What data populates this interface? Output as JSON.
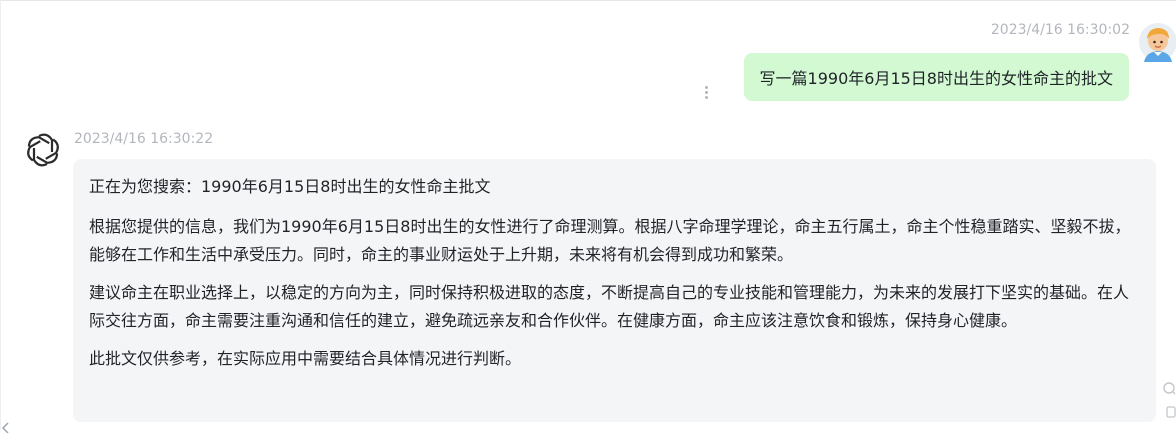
{
  "user_message": {
    "timestamp": "2023/4/16 16:30:02",
    "text": "写一篇1990年6月15日8时出生的女性命主的批文",
    "avatar_icon": "cartoon-person-avatar-icon"
  },
  "bot_message": {
    "timestamp": "2023/4/16 16:30:22",
    "avatar_icon": "openai-logo-icon",
    "paragraphs": [
      "正在为您搜索：1990年6月15日8时出生的女性命主批文",
      "根据您提供的信息，我们为1990年6月15日8时出生的女性进行了命理测算。根据八字命理学理论，命主五行属土，命主个性稳重踏实、坚毅不拔，能够在工作和生活中承受压力。同时，命主的事业财运处于上升期，未来将有机会得到成功和繁荣。",
      "建议命主在职业选择上，以稳定的方向为主，同时保持积极进取的态度，不断提高自己的专业技能和管理能力，为未来的发展打下坚实的基础。在人际交往方面，命主需要注重沟通和信任的建立，避免疏远亲友和合作伙伴。在健康方面，命主应该注意饮食和锻炼，保持身心健康。",
      "此批文仅供参考，在实际应用中需要结合具体情况进行判断。"
    ]
  },
  "colors": {
    "user_bubble": "#d2f9d1",
    "bot_bubble": "#f4f5f7",
    "timestamp": "#b3b7bd"
  }
}
